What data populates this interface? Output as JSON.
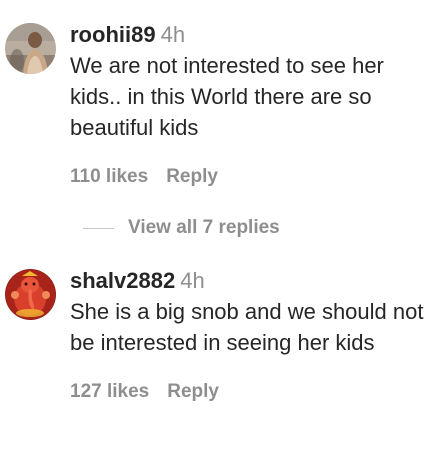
{
  "comments": [
    {
      "username": "roohii89",
      "time": "4h",
      "text": "We are not interested to see her kids.. in this World there are so beautiful kids",
      "likes": "110 likes",
      "reply": "Reply",
      "avatar_icon": "user-avatar-photo"
    },
    {
      "username": "shalv2882",
      "time": "4h",
      "text": "She is a big snob and we should not be interested in seeing her kids",
      "likes": "127 likes",
      "reply": "Reply",
      "avatar_icon": "ganesha-avatar-photo"
    }
  ],
  "replies_link": {
    "label": "View all 7 replies"
  },
  "colors": {
    "text": "#262626",
    "secondary": "#8e8e8e",
    "divider": "#c7c7c7"
  }
}
